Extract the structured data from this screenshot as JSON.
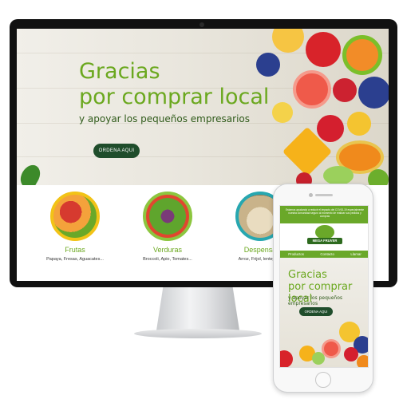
{
  "desktop": {
    "hero": {
      "title_line1": "Gracias",
      "title_line2": "por comprar local",
      "subtitle": "y apoyar los pequeños empresarios",
      "cta_label": "ORDENA AQUI"
    },
    "categories": [
      {
        "name": "Frutas",
        "description": "Papaya, Fresas, Aguacates...",
        "icon": "fruit-basket-image"
      },
      {
        "name": "Verduras",
        "description": "Broccoli, Apio, Tomates...",
        "icon": "vegetables-image"
      },
      {
        "name": "Despensa",
        "description": "Arroz, Frijol, lentejas...",
        "icon": "pantry-sacks-image"
      }
    ]
  },
  "mobile": {
    "banner": "Estamos ayudando a reducir el impacto del COVID-19 especialmente nuestra comunidad seguro al momento de realizar sus pedidos y compras",
    "logo_text": "MEGA FRUVER",
    "nav": [
      "Productos",
      "Contacto",
      "Llamar"
    ],
    "hero": {
      "title_line1": "Gracias",
      "title_line2": "por comprar local",
      "subtitle": "y apoyar los pequeños empresarios",
      "cta_label": "ORDENA AQUI"
    }
  },
  "colors": {
    "brand_green": "#6ba81f",
    "dark_green": "#1f4d2b",
    "category_ring": "#f2c317"
  }
}
